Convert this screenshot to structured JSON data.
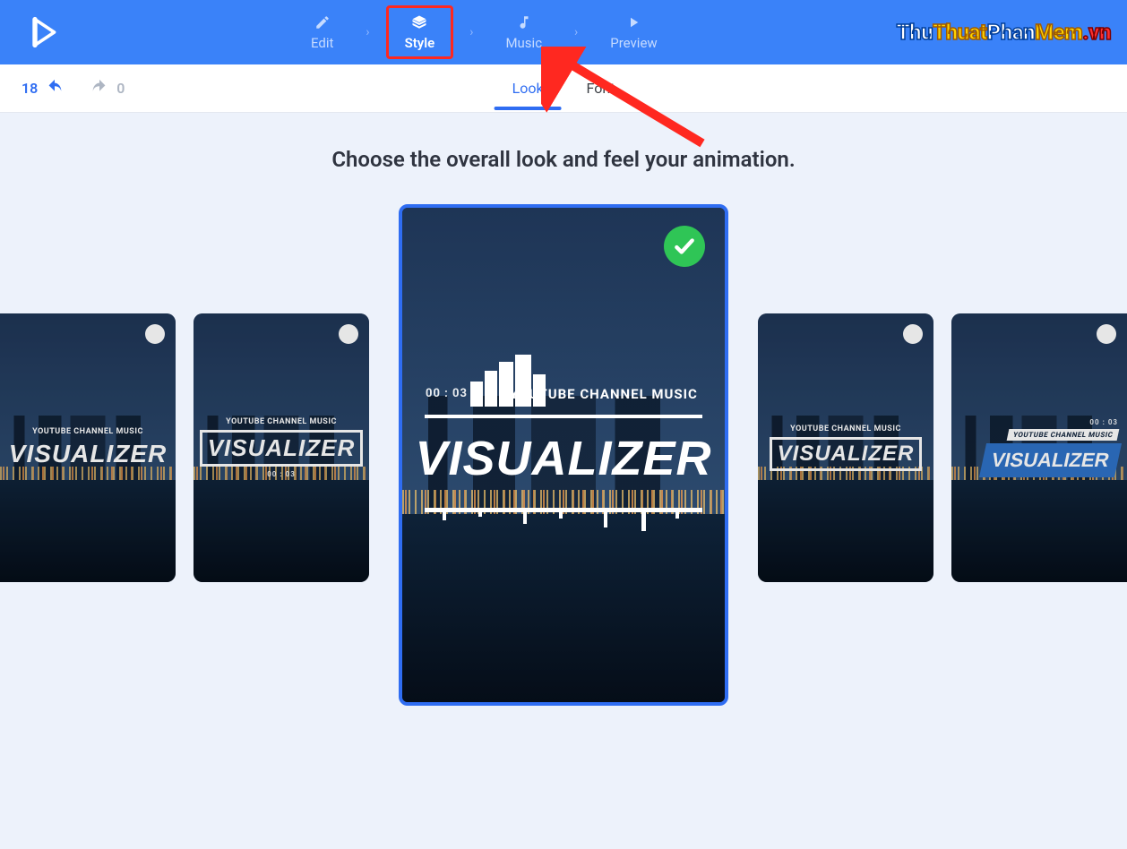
{
  "nav": {
    "steps": [
      {
        "label": "Edit",
        "icon": "pencil-icon"
      },
      {
        "label": "Style",
        "icon": "layers-icon",
        "active": true,
        "highlighted": true
      },
      {
        "label": "Music",
        "icon": "music-note-icon"
      },
      {
        "label": "Preview",
        "icon": "play-icon"
      }
    ]
  },
  "watermark": {
    "p1": "Thu",
    "p2": "Thuat",
    "p3": "Phan",
    "p4": "Mem",
    "p5": ".vn"
  },
  "history": {
    "undo_count": "18",
    "redo_count": "0"
  },
  "tabs": {
    "look": "Look",
    "font": "Font",
    "active": "look"
  },
  "heading": "Choose the overall look and feel your animation.",
  "template": {
    "channel_label": "YOUTUBE CHANNEL MUSIC",
    "title": "VISUALIZER",
    "timecode": "00 : 03"
  },
  "cards": [
    {
      "id": "c1",
      "selected": false
    },
    {
      "id": "c2",
      "selected": false
    },
    {
      "id": "center",
      "selected": true
    },
    {
      "id": "c4",
      "selected": false
    },
    {
      "id": "c5",
      "selected": false
    }
  ],
  "colors": {
    "primary": "#3a82f9",
    "accent": "#2f6df2",
    "check": "#2fc556",
    "highlight": "#ff2820"
  }
}
